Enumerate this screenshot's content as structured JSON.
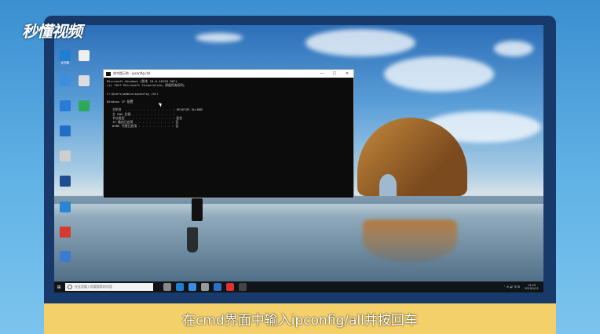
{
  "watermark": {
    "logo_text": "秒懂视频"
  },
  "desktop_icons": [
    {
      "label": "此电脑",
      "color": "#1e7fd0"
    },
    {
      "label": "",
      "color": "#eeeeee"
    },
    {
      "label": "",
      "color": "#3c8fe0"
    },
    {
      "label": "",
      "color": "#dddddd"
    },
    {
      "label": "",
      "color": "#2a7ad6"
    },
    {
      "label": "",
      "color": "#2fa85a"
    },
    {
      "label": "",
      "color": "#1f6fc8"
    },
    {
      "label": "",
      "color": "#cfcfcf"
    },
    {
      "label": "",
      "color": "#1c4f8f"
    },
    {
      "label": "",
      "color": "#2a86d4"
    },
    {
      "label": "",
      "color": "#d43a2f"
    },
    {
      "label": "",
      "color": "#3b7bd1"
    }
  ],
  "cmd": {
    "title": "命令提示符 - ipconfig /all",
    "minimize": "—",
    "maximize": "☐",
    "close": "✕",
    "lines": [
      "Microsoft Windows [版本 10.0.16299.967]",
      "(c) 2017 Microsoft Corporation。保留所有权利。",
      "",
      "C:\\Users\\admin>ipconfig /all",
      "",
      "Windows IP 配置",
      "",
      "   主机名  . . . . . . . . . . . . . : DESKTOP-3LL6BB",
      "   主 DNS 后缀 . . . . . . . . . . . :",
      "   节点类型  . . . . . . . . . . . . : 混合",
      "   IP 路由已启用 . . . . . . . . . . : 否",
      "   WINS 代理已启用 . . . . . . . . . : 否"
    ]
  },
  "taskbar": {
    "search_placeholder": "在这里输入你要搜索的内容",
    "icons": [
      "#888888",
      "#1e7fd0",
      "#3a8de0",
      "#999999",
      "#2c6fc8",
      "#dd3333",
      "#444444"
    ],
    "tray_icons": "⌃ ✉ 🔊 中 ⊞",
    "time": "11:23",
    "date": "2019/1/11"
  },
  "caption": {
    "text": "在cmd界面中输入ipconfig/all并按回车"
  }
}
